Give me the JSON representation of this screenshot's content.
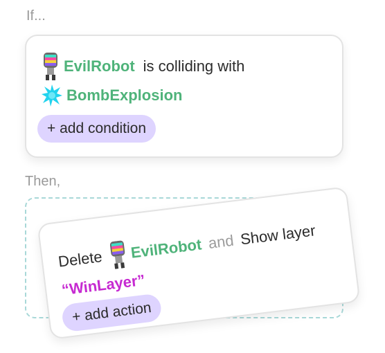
{
  "if_label": "If...",
  "then_label": "Then,",
  "condition": {
    "subject": "EvilRobot",
    "relation": "is colliding with",
    "target": "BombExplosion",
    "add_button": "+ add condition"
  },
  "action": {
    "verb": "Delete",
    "subject": "EvilRobot",
    "conjunction": "and",
    "verb2": "Show layer",
    "layer_name": "“WinLayer”",
    "add_button": "+ add action"
  },
  "colors": {
    "object": "#4fb37a",
    "string": "#c62ad1",
    "pill": "#ded4ff",
    "dropzone": "#a8d8d8"
  },
  "icons": [
    "robot-icon",
    "bomb-explosion-icon"
  ]
}
